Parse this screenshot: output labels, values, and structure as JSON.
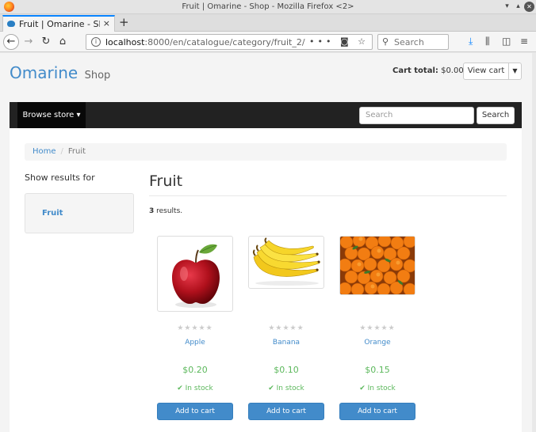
{
  "window": {
    "title": "Fruit | Omarine - Shop - Mozilla Firefox <2>"
  },
  "tab": {
    "title": "Fruit | Omarine - Shop",
    "close": "×"
  },
  "newtab": "+",
  "nav": {
    "url_host": "localhost",
    "url_rest": ":8000/en/catalogue/category/fruit_2/",
    "search_placeholder": "Search"
  },
  "header": {
    "brand": "Omarine",
    "brand_sub": "Shop",
    "cart_label": "Cart total:",
    "cart_value": "$0.00",
    "view_cart": "View cart"
  },
  "sitenav": {
    "browse_store": "Browse store",
    "search_placeholder": "Search",
    "search_button": "Search"
  },
  "breadcrumb": {
    "home": "Home",
    "sep": "/",
    "current": "Fruit"
  },
  "sidebar": {
    "title": "Show results for",
    "link": "Fruit"
  },
  "main": {
    "title": "Fruit",
    "result_count": "3",
    "result_text": " results."
  },
  "products": [
    {
      "name": "Apple",
      "price": "$0.20",
      "stock": "In stock",
      "button": "Add to cart",
      "image": "apple"
    },
    {
      "name": "Banana",
      "price": "$0.10",
      "stock": "In stock",
      "button": "Add to cart",
      "image": "banana"
    },
    {
      "name": "Orange",
      "price": "$0.15",
      "stock": "In stock",
      "button": "Add to cart",
      "image": "orange"
    }
  ],
  "colors": {
    "link": "#428bca",
    "success": "#5cb85c",
    "nav_dark": "#222222"
  }
}
